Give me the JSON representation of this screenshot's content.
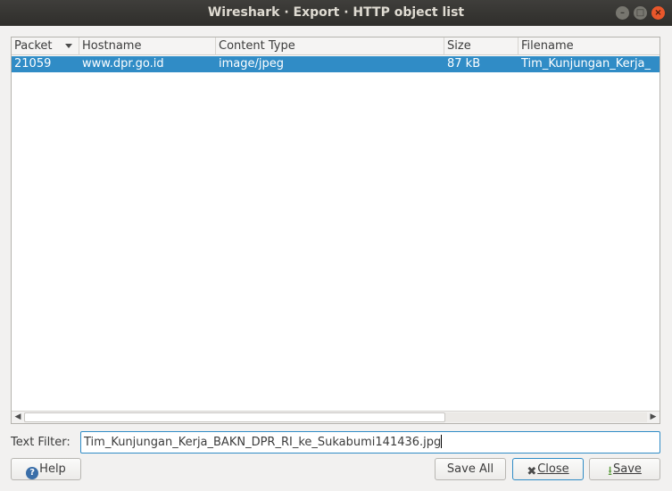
{
  "window": {
    "title": "Wireshark · Export · HTTP object list",
    "controls": {
      "minimize_icon": "–",
      "maximize_icon": "□",
      "close_icon": "×"
    }
  },
  "table": {
    "columns": [
      "Packet",
      "Hostname",
      "Content Type",
      "Size",
      "Filename"
    ],
    "sort_column": "Packet",
    "rows": [
      {
        "packet": "21059",
        "hostname": "www.dpr.go.id",
        "content_type": "image/jpeg",
        "size": "87 kB",
        "filename": "Tim_Kunjungan_Kerja_"
      }
    ],
    "selected_row_color": "#308cc6"
  },
  "filter": {
    "label": "Text Filter:",
    "value": "Tim_Kunjungan_Kerja_BAKN_DPR_RI_ke_Sukabumi141436.jpg"
  },
  "buttons": {
    "help": {
      "icon": "?",
      "label": "Help"
    },
    "save_all": "Save All",
    "close": {
      "icon": "✖",
      "label": "Close"
    },
    "save": {
      "icon": "⭳",
      "label": "Save"
    }
  }
}
